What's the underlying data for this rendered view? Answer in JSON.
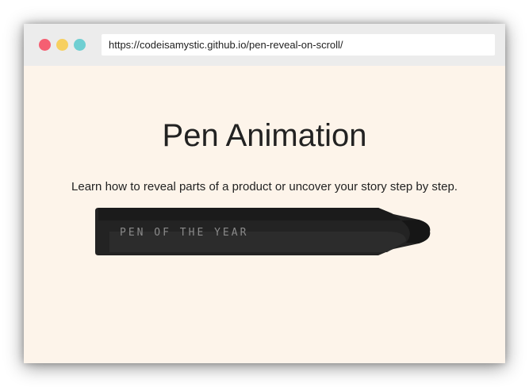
{
  "browser": {
    "url": "https://codeisamystic.github.io/pen-reveal-on-scroll/",
    "dots": {
      "close_color": "#f55f72",
      "minimize_color": "#f7d060",
      "maximize_color": "#6fcfd2"
    }
  },
  "page": {
    "title": "Pen Animation",
    "subtitle": "Learn how to reveal parts of a product or uncover your story step by step.",
    "pen_label": "PEN OF THE YEAR",
    "background_color": "#fdf4ea"
  }
}
